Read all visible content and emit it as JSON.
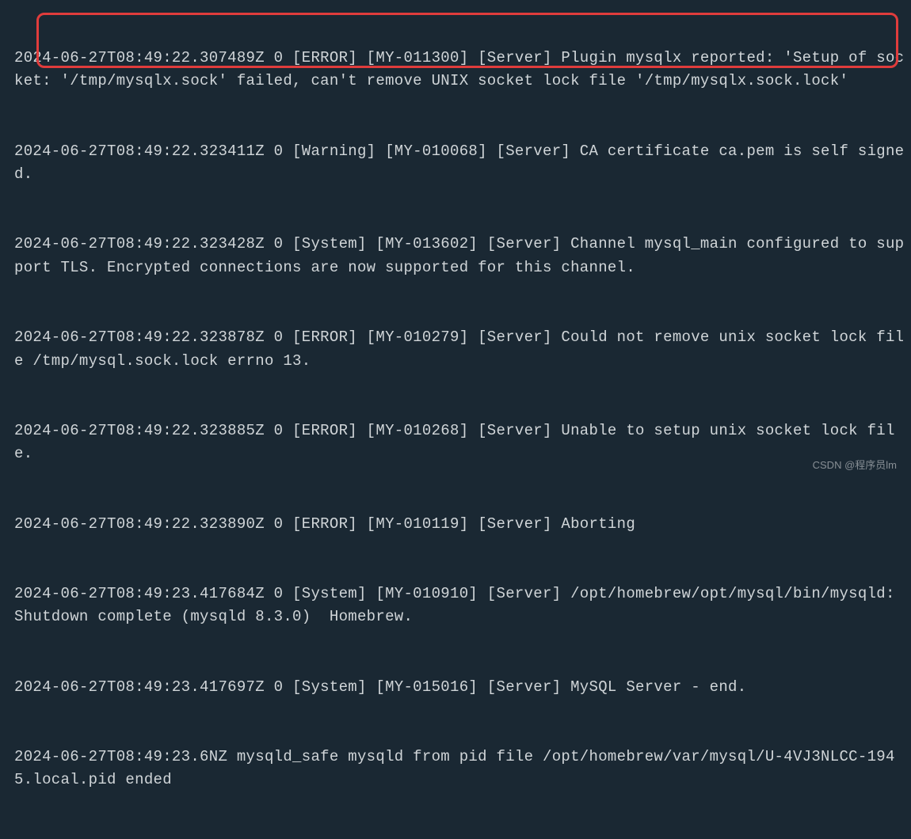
{
  "log_lines": [
    "2024-06-27T08:49:22.307489Z 0 [ERROR] [MY-011300] [Server] Plugin mysqlx reported: 'Setup of socket: '/tmp/mysqlx.sock' failed, can't remove UNIX socket lock file '/tmp/mysqlx.sock.lock'",
    "2024-06-27T08:49:22.323411Z 0 [Warning] [MY-010068] [Server] CA certificate ca.pem is self signed.",
    "2024-06-27T08:49:22.323428Z 0 [System] [MY-013602] [Server] Channel mysql_main configured to support TLS. Encrypted connections are now supported for this channel.",
    "2024-06-27T08:49:22.323878Z 0 [ERROR] [MY-010279] [Server] Could not remove unix socket lock file /tmp/mysql.sock.lock errno 13.",
    "2024-06-27T08:49:22.323885Z 0 [ERROR] [MY-010268] [Server] Unable to setup unix socket lock file.",
    "2024-06-27T08:49:22.323890Z 0 [ERROR] [MY-010119] [Server] Aborting",
    "2024-06-27T08:49:23.417684Z 0 [System] [MY-010910] [Server] /opt/homebrew/opt/mysql/bin/mysqld: Shutdown complete (mysqld 8.3.0)  Homebrew.",
    "2024-06-27T08:49:23.417697Z 0 [System] [MY-015016] [Server] MySQL Server - end.",
    "2024-06-27T08:49:23.6NZ mysqld_safe mysqld from pid file /opt/homebrew/var/mysql/U-4VJ3NLCC-1945.local.pid ended"
  ],
  "watermark": "CSDN @程序员lm",
  "highlight": {
    "color": "#e03c3c"
  }
}
